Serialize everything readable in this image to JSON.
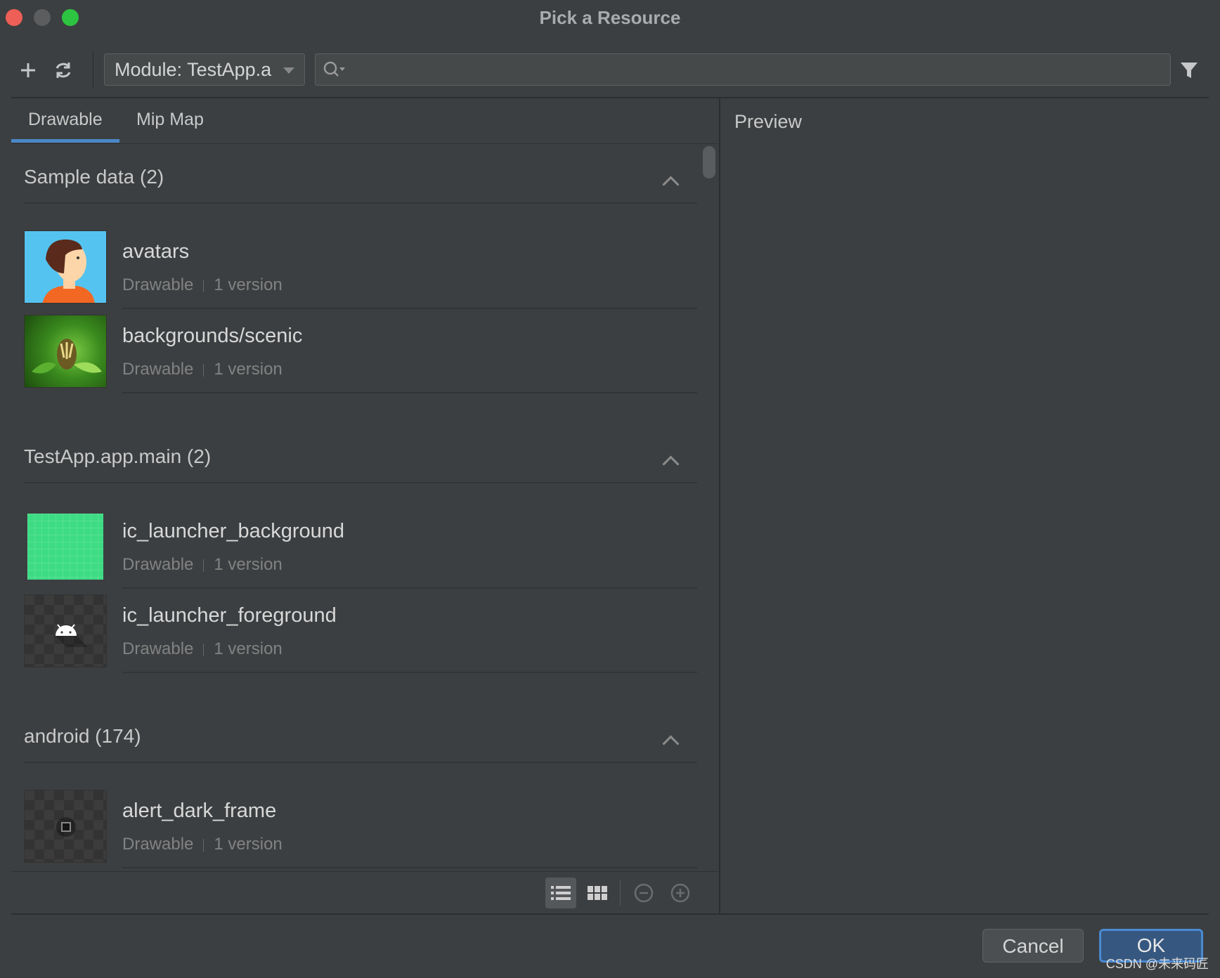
{
  "window": {
    "title": "Pick a Resource"
  },
  "toolbar": {
    "add_icon": "plus-icon",
    "refresh_icon": "refresh-icon",
    "module_label": "Module: TestApp.a",
    "search_placeholder": "",
    "filter_icon": "filter-icon"
  },
  "tabs": [
    {
      "label": "Drawable",
      "selected": true
    },
    {
      "label": "Mip Map",
      "selected": false
    }
  ],
  "sections": [
    {
      "title": "Sample data (2)",
      "items": [
        {
          "name": "avatars",
          "type": "Drawable",
          "versions": "1 version"
        },
        {
          "name": "backgrounds/scenic",
          "type": "Drawable",
          "versions": "1 version"
        }
      ]
    },
    {
      "title": "TestApp.app.main (2)",
      "items": [
        {
          "name": "ic_launcher_background",
          "type": "Drawable",
          "versions": "1 version"
        },
        {
          "name": "ic_launcher_foreground",
          "type": "Drawable",
          "versions": "1 version"
        }
      ]
    },
    {
      "title": "android (174)",
      "items": [
        {
          "name": "alert_dark_frame",
          "type": "Drawable",
          "versions": "1 version"
        }
      ]
    }
  ],
  "preview": {
    "label": "Preview"
  },
  "buttons": {
    "cancel": "Cancel",
    "ok": "OK"
  },
  "watermark": "CSDN @未来码匠",
  "colors": {
    "accent": "#4a88c7",
    "ok_button": "#365880",
    "background": "#3c3f41"
  }
}
